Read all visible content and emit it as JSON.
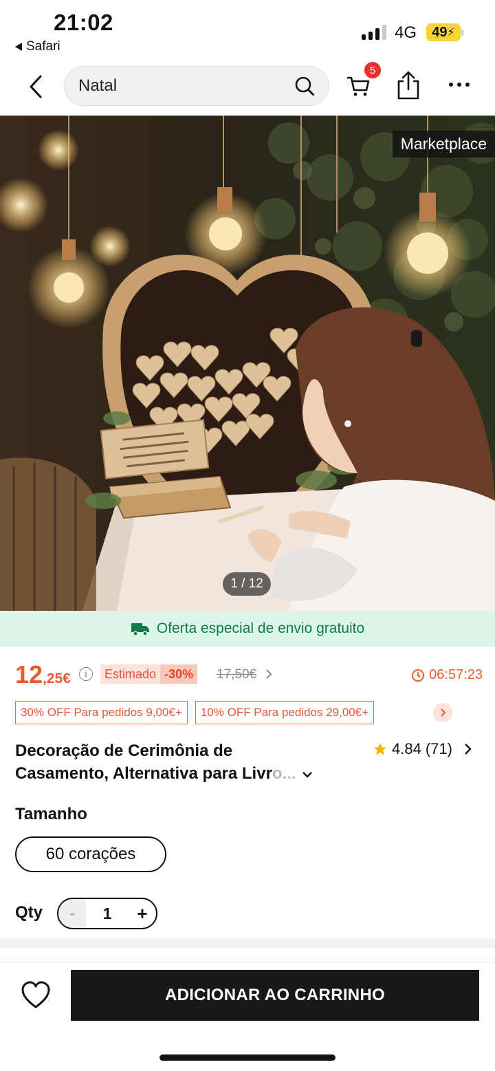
{
  "status_bar": {
    "time": "21:02",
    "back_app": "Safari",
    "network": "4G",
    "battery": "49"
  },
  "nav": {
    "search_value": "Natal",
    "cart_count": "5"
  },
  "hero": {
    "tag": "Marketplace",
    "pager": "1 / 12"
  },
  "shipping_banner": {
    "text": "Oferta especial de envio gratuito",
    "color": "#157a4a"
  },
  "price": {
    "int": "12",
    "dec": ",25€",
    "estimated_label": "Estimado",
    "discount": "-30%",
    "original": "17,50€",
    "timer": "06:57:23",
    "accent": "#ec5b2d"
  },
  "coupons": [
    {
      "text": "30% OFF Para pedidos 9,00€+"
    },
    {
      "text": "10% OFF Para pedidos 29,00€+"
    }
  ],
  "product": {
    "title_line1": "Decoração de Cerimônia de",
    "title_line2": "Casamento, Alternativa para Livr",
    "title_fade": "o...",
    "rating": "4.84",
    "reviews": "(71)"
  },
  "options": {
    "size_label": "Tamanho",
    "size_value": "60 corações"
  },
  "quantity": {
    "label": "Qty",
    "minus": "-",
    "value": "1",
    "plus": "+"
  },
  "actions": {
    "add_to_cart": "ADICIONAR AO CARRINHO"
  }
}
